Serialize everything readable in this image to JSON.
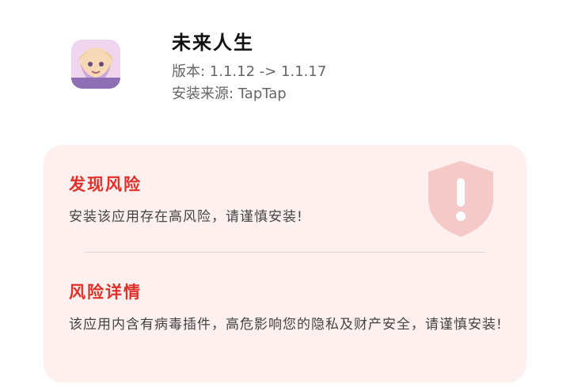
{
  "app": {
    "name": "未来人生",
    "version_text": "版本: 1.1.12 -> 1.1.17",
    "source_text": "安装来源: TapTap",
    "icon": "app-avatar-icon"
  },
  "risk": {
    "title": "发现风险",
    "message": "安装该应用存在高风险，请谨慎安装!",
    "icon": "shield-exclamation-icon"
  },
  "details": {
    "title": "风险详情",
    "message": "该应用内含有病毒插件，高危影响您的隐私及财产安全，请谨慎安装!"
  },
  "colors": {
    "accent": "#e0312a",
    "card_bg": "#fdf0ef",
    "shield": "#f6c9c9"
  }
}
